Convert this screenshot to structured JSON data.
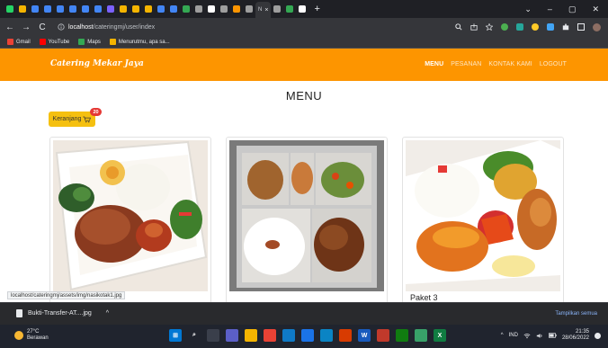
{
  "browser": {
    "tabs": [
      {
        "color": "#25d366"
      },
      {
        "color": "#f4b400"
      },
      {
        "color": "#4285f4"
      },
      {
        "color": "#4285f4"
      },
      {
        "color": "#4285f4"
      },
      {
        "color": "#4285f4"
      },
      {
        "color": "#4285f4"
      },
      {
        "color": "#4285f4"
      },
      {
        "color": "#7b61ff"
      },
      {
        "color": "#f4b400"
      },
      {
        "color": "#f4b400"
      },
      {
        "color": "#f4b400"
      },
      {
        "color": "#4285f4"
      },
      {
        "color": "#4285f4"
      },
      {
        "color": "#34a853"
      },
      {
        "color": "#9e9e9e"
      },
      {
        "color": "#ffffff"
      },
      {
        "color": "#9e9e9e"
      },
      {
        "color": "#fd9500"
      },
      {
        "color": "#9e9e9e"
      },
      {
        "color": "#9e9e9e"
      },
      {
        "color": "#34a853"
      },
      {
        "color": "#ffffff"
      }
    ],
    "active_tab_label": "N",
    "active_tab_close": "×",
    "new_tab": "+",
    "window_controls": {
      "minimize": "–",
      "maximize": "▢",
      "close": "✕",
      "tabsearch": "⌄"
    },
    "back": "←",
    "forward": "→",
    "reload": "C",
    "address": {
      "host": "localhost",
      "path": "/cateringmj/user/index"
    },
    "bookmarks": [
      {
        "label": "Gmail",
        "color": "#ea4335"
      },
      {
        "label": "YouTube",
        "color": "#ff0000"
      },
      {
        "label": "Maps",
        "color": "#34a853"
      },
      {
        "label": "Menurutmu, apa sa...",
        "color": "#f4b400"
      }
    ]
  },
  "site": {
    "brand": "Catering Mekar Jaya",
    "nav": [
      "MENU",
      "PESANAN",
      "KONTAK KAMI",
      "LOGOUT"
    ],
    "title": "MENU",
    "cart_label": "Keranjang",
    "cart_count": "20",
    "cards": [
      {
        "caption": ""
      },
      {
        "caption": ""
      },
      {
        "caption": "Paket 3"
      }
    ]
  },
  "status_url": "localhost/cateringmj/assets/img/nasikotak1.jpg",
  "download": {
    "file": "Bukti-Transfer-AT....jpg",
    "chevron": "^",
    "show_all": "Tampilkan semua"
  },
  "taskbar": {
    "temp": "27°C",
    "condition": "Berawan",
    "lang": "IND",
    "time": "21:35",
    "date": "28/06/2022",
    "apps": [
      {
        "color": "#0078d4",
        "glyph": "⊞"
      },
      {
        "color": "#20242e",
        "glyph": "⌕"
      },
      {
        "color": "#3a3f4b",
        "glyph": ""
      },
      {
        "color": "#5b5fc7",
        "glyph": ""
      },
      {
        "color": "#f4b400",
        "glyph": ""
      },
      {
        "color": "#e94235",
        "glyph": ""
      },
      {
        "color": "#0f7ac7",
        "glyph": ""
      },
      {
        "color": "#1a73e8",
        "glyph": ""
      },
      {
        "color": "#0a84c4",
        "glyph": ""
      },
      {
        "color": "#d83b01",
        "glyph": ""
      },
      {
        "color": "#185abd",
        "glyph": "W"
      },
      {
        "color": "#c0392b",
        "glyph": ""
      },
      {
        "color": "#107c10",
        "glyph": ""
      },
      {
        "color": "#38a169",
        "glyph": ""
      },
      {
        "color": "#107c41",
        "glyph": "X"
      }
    ]
  }
}
